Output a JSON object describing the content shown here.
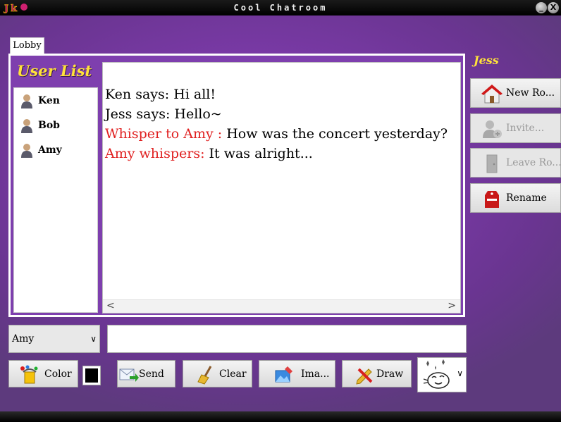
{
  "window": {
    "title": "Cool Chatroom",
    "minimize_label": "_",
    "close_label": "X"
  },
  "tabs": [
    {
      "label": "Lobby"
    }
  ],
  "user_list": {
    "title": "User List",
    "users": [
      {
        "name": "Ken",
        "icon": "user-icon"
      },
      {
        "name": "Bob",
        "icon": "user-icon"
      },
      {
        "name": "Amy",
        "icon": "user-icon"
      }
    ]
  },
  "chat": {
    "messages": [
      {
        "prefix": "",
        "text": "Ken says: Hi all!"
      },
      {
        "prefix": "",
        "text": "Jess says: Hello~"
      },
      {
        "prefix": "Whisper to Amy : ",
        "text": "How was the concert yesterday?"
      },
      {
        "prefix": "Amy whispers: ",
        "text": "It was alright..."
      }
    ],
    "scroll_left": "<",
    "scroll_right": ">",
    "whisper_color": "#e02020"
  },
  "current_user": "Jess",
  "side_buttons": [
    {
      "label": "New Ro...",
      "icon": "house-icon",
      "enabled": true
    },
    {
      "label": "Invite...",
      "icon": "invite-user-icon",
      "enabled": false
    },
    {
      "label": "Leave Ro...",
      "icon": "door-icon",
      "enabled": false
    },
    {
      "label": "Rename",
      "icon": "name-tag-icon",
      "enabled": true
    }
  ],
  "composer": {
    "recipient": "Amy",
    "message_value": "",
    "selected_color": "#000000"
  },
  "toolbar": {
    "color_label": "Color",
    "send_label": "Send",
    "clear_label": "Clear",
    "image_label": "Ima...",
    "draw_label": "Draw"
  },
  "colors": {
    "accent_yellow": "#ffe23a",
    "background_purple": "#7b3aa8"
  }
}
